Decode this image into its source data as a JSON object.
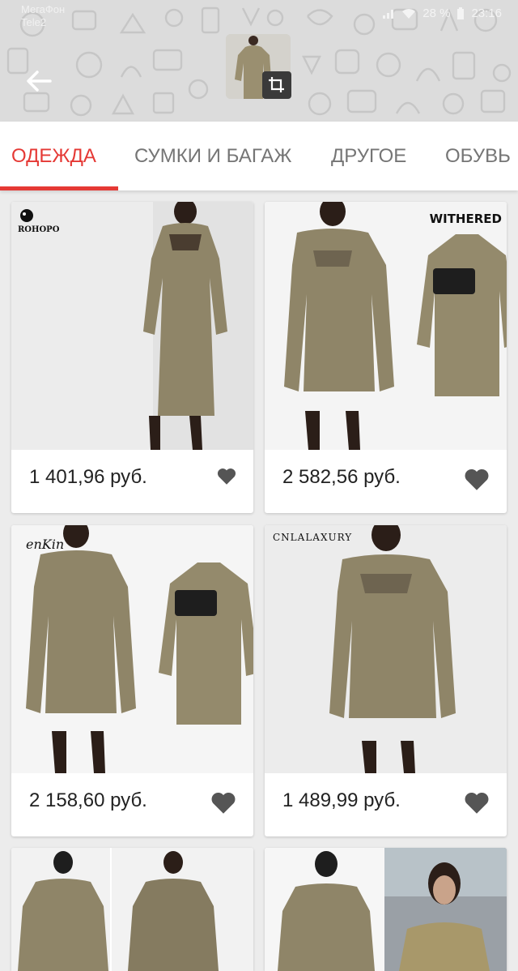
{
  "status_bar": {
    "carrier_line1": "МегаФон",
    "carrier_line2": "Tele2",
    "battery": "28 %",
    "time": "23:16"
  },
  "header": {
    "back_icon": "arrow-left-icon",
    "crop_icon": "crop-icon"
  },
  "tabs": [
    {
      "label": "ОДЕЖДА",
      "active": true
    },
    {
      "label": "СУМКИ И БАГАЖ",
      "active": false
    },
    {
      "label": "ДРУГОЕ",
      "active": false
    },
    {
      "label": "ОБУВЬ",
      "active": false
    }
  ],
  "products": [
    {
      "price": "1 401,96 руб.",
      "brand": "ROHOPO"
    },
    {
      "price": "2 582,56 руб.",
      "brand": "WITHERED"
    },
    {
      "price": "2 158,60 руб.",
      "brand": "enKin"
    },
    {
      "price": "1 489,99 руб.",
      "brand": "CNLALAXURY"
    }
  ],
  "colors": {
    "accent": "#e53935",
    "dress": "#8f8568",
    "heart": "#555555"
  }
}
